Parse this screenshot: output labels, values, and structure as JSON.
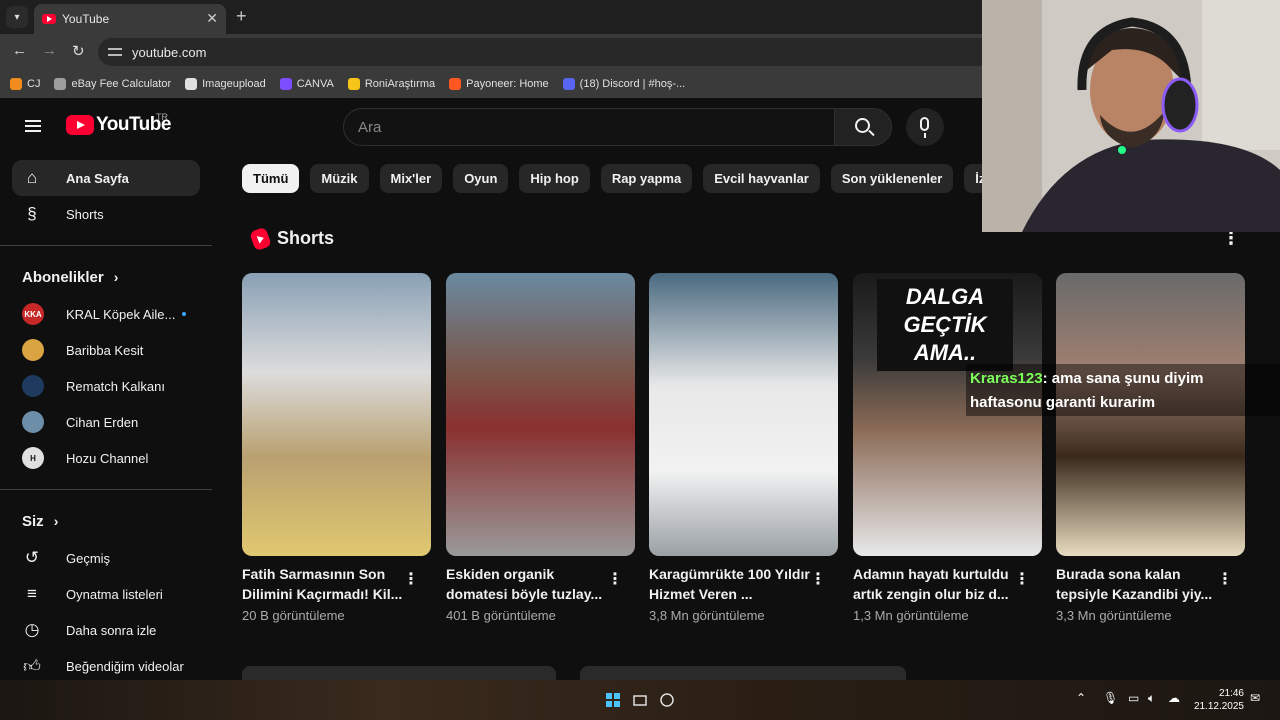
{
  "browser": {
    "tab_title": "YouTube",
    "url": "youtube.com",
    "bookmarks": [
      {
        "label": "CJ",
        "color": "#f28b1e"
      },
      {
        "label": "eBay Fee Calculator",
        "color": "#9e9e9e"
      },
      {
        "label": "Imageupload",
        "color": "#e0e0e0"
      },
      {
        "label": "CANVA",
        "color": "#7c4dff"
      },
      {
        "label": "RoniAraştırma",
        "color": "#f5c518"
      },
      {
        "label": "Payoneer: Home",
        "color": "#ff5722"
      },
      {
        "label": "(18) Discord | #hoş-...",
        "color": "#5865f2"
      }
    ]
  },
  "youtube": {
    "logo_text": "YouTube",
    "logo_region": "TR",
    "search_placeholder": "Ara"
  },
  "sidebar": {
    "main": [
      {
        "label": "Ana Sayfa",
        "icon": "home-icon"
      },
      {
        "label": "Shorts",
        "icon": "shorts-icon"
      }
    ],
    "subscriptions_title": "Abonelikler",
    "subscriptions": [
      {
        "label": "KRAL Köpek Aile...",
        "avatar_color": "#c62828",
        "badge": "KKA"
      },
      {
        "label": "Baribba Kesit",
        "avatar_color": "#d9a441",
        "badge": ""
      },
      {
        "label": "Rematch Kalkanı",
        "avatar_color": "#1e3a5f",
        "badge": ""
      },
      {
        "label": "Cihan Erden",
        "avatar_color": "#6d8ea8",
        "badge": ""
      },
      {
        "label": "Hozu Channel",
        "avatar_color": "#e0e0e0",
        "badge": "H"
      }
    ],
    "you_title": "Siz",
    "you": [
      {
        "label": "Geçmiş",
        "icon": "history-icon"
      },
      {
        "label": "Oynatma listeleri",
        "icon": "playlist-icon"
      },
      {
        "label": "Daha sonra izle",
        "icon": "clock-icon"
      },
      {
        "label": "Beğendiğim videolar",
        "icon": "like-icon"
      }
    ]
  },
  "chips": [
    "Tümü",
    "Müzik",
    "Mix'ler",
    "Oyun",
    "Hip hop",
    "Rap yapma",
    "Evcil hayvanlar",
    "Son yüklenenler",
    "İzlenenl"
  ],
  "shorts": {
    "title": "Shorts",
    "items": [
      {
        "title": "Fatih Sarmasının Son Dilimini Kaçırmadı! Kil...",
        "views": "20 B görüntüleme",
        "overlay": ""
      },
      {
        "title": "Eskiden organik domatesi böyle tuzlay...",
        "views": "401 B görüntüleme",
        "overlay": ""
      },
      {
        "title": "Karagümrükte 100 Yıldır Hizmet Veren ...",
        "views": "3,8 Mn görüntüleme",
        "overlay": ""
      },
      {
        "title": "Adamın hayatı kurtuldu artık zengin olur biz d...",
        "views": "1,3 Mn görüntüleme",
        "overlay": "DALGA GEÇTİK AMA.."
      },
      {
        "title": "Burada sona kalan tepsiyle Kazandibi yiy...",
        "views": "3,3 Mn görüntüleme",
        "overlay": ""
      }
    ]
  },
  "chat": {
    "user": "Kraras123",
    "message": ": ama sana şunu diyim haftasonu garanti kurarim"
  },
  "taskbar": {
    "time": "21:46",
    "date": "21.12.2025"
  }
}
